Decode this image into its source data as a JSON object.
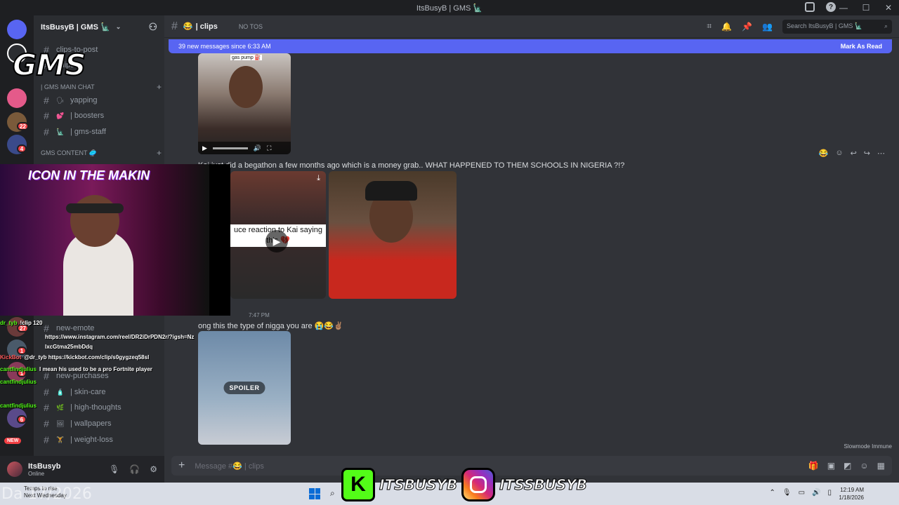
{
  "window": {
    "title": "ItsBusyB | GMS 🗽"
  },
  "guild": {
    "name": "ItsBusyB | GMS 🗽",
    "logo_text": "GMS"
  },
  "channels": {
    "top": [
      {
        "label": "clips-to-post"
      },
      {
        "label": "-clips"
      }
    ],
    "cat_main": "| GMS MAIN CHAT",
    "main": [
      {
        "label": "yapping",
        "emoji": "🗣"
      },
      {
        "label": "| boosters",
        "emoji": "💕"
      },
      {
        "label": "| gms-staff",
        "emoji": "🗽"
      }
    ],
    "cat_content": "GMS CONTENT 🥏",
    "lower": [
      {
        "label": "new-emote"
      },
      {
        "label": "new-purchases"
      },
      {
        "label": "| skin-care",
        "emoji": "🧴"
      },
      {
        "label": "| high-thoughts",
        "emoji": "🌿"
      },
      {
        "label": "| wallpapers",
        "emoji": "🖼"
      },
      {
        "label": "| weight-loss",
        "emoji": "🏋"
      }
    ]
  },
  "server_badges": [
    "22",
    "4",
    "27",
    "1",
    "1",
    "6"
  ],
  "server_new": "NEW",
  "user": {
    "name": "ItsBusyb",
    "status": "Online"
  },
  "header": {
    "channel": "| clips",
    "channel_emoji": "😂",
    "topic": "NO TOS",
    "search_placeholder": "Search ItsBusyB | GMS 🗽"
  },
  "new_messages": {
    "text": "39 new messages since 6:33 AM",
    "action": "Mark As Read"
  },
  "messages": [
    {
      "text": "Kai just did a begathon a few months ago which is a money grab.. WHAT HAPPENED TO THEM SCHOOLS IN NIGERIA ?!?"
    },
    {
      "time": "7:47 PM",
      "text": "ong this the type of nigga you are 😭😂✌🏽"
    }
  ],
  "video_caption": "uce reaction to Kai saying this 💔",
  "gas_pump_caption": "gas pump ⛽",
  "spoiler": "SPOILER",
  "slowmode": "Slowmode Immune",
  "composer": {
    "placeholder": "Message #😂 | clips"
  },
  "stream_overlay": {
    "cam_title": "ICON IN THE MAKIN",
    "chat": [
      {
        "user": "dr_tyb",
        "text": "!clip 120"
      },
      {
        "user": "",
        "text": "https://www.instagram.com/reel/DR2iDrPDN2r/?igsh=NzlxcGtma25mbDdq"
      },
      {
        "user": "KickBot",
        "text": "@dr_tyb https://kickbot.com/clip/s0gygzeq58sl"
      },
      {
        "user": "cantfindjulius",
        "text": "I mean his used to be a pro Fortnite player"
      },
      {
        "user": "cantfindjulius",
        "text": ""
      },
      {
        "user": "cantfindjulius",
        "text": ""
      }
    ],
    "kick_handle": "ITSBUSYB",
    "ig_handle": "ITSSBUSYB",
    "date_overlay": "Da  17/2026"
  },
  "taskbar": {
    "weather_line1": "Temps to rise",
    "weather_line2": "Next Wednesday",
    "time": "12:19 AM",
    "date": "1/18/2026"
  }
}
